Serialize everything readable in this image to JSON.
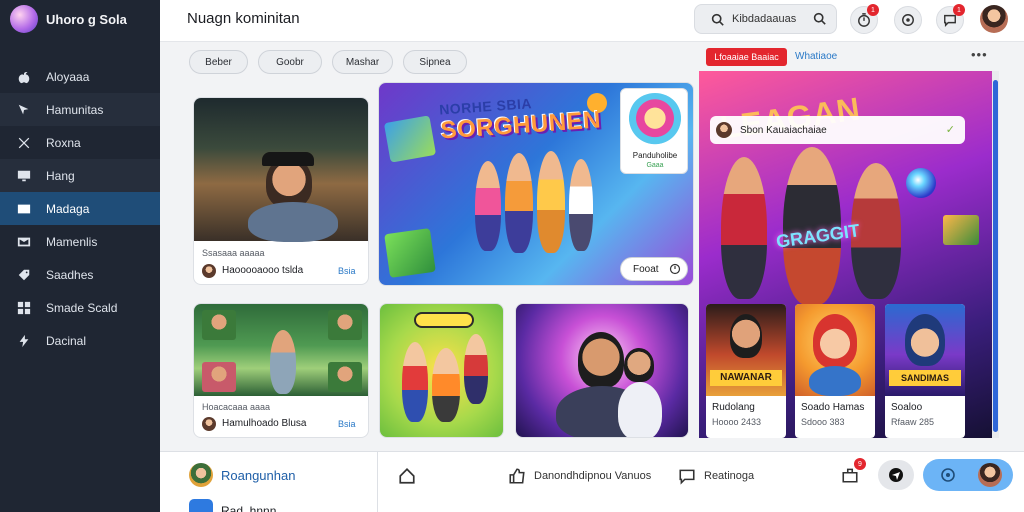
{
  "app": {
    "name": "Uhoro g Sola"
  },
  "sidebar": {
    "items": [
      {
        "label": "Aloyaaa",
        "icon": "apple-icon"
      },
      {
        "label": "Hamunitas",
        "icon": "cursor-icon"
      },
      {
        "label": "Roxna",
        "icon": "cross-icon"
      },
      {
        "label": "Hang",
        "icon": "monitor-icon"
      },
      {
        "label": "Madaga",
        "icon": "media-icon",
        "active": true
      },
      {
        "label": "Mamenlis",
        "icon": "inbox-icon"
      },
      {
        "label": "Saadhes",
        "icon": "tag-icon"
      },
      {
        "label": "Smade Scald",
        "icon": "grid-icon"
      },
      {
        "label": "Dacinal",
        "icon": "bolt-icon"
      }
    ]
  },
  "header": {
    "title": "Nuagn kominitan",
    "search_value": "Kibdadaauas",
    "notif_badge": "1",
    "msg_badge": "1",
    "icons": [
      "timer-icon",
      "record-icon",
      "chat-icon"
    ]
  },
  "chips": [
    "Beber",
    "Goobr",
    "Mashar",
    "Sipnea"
  ],
  "cards": {
    "street": {
      "meta": "Ssasaaa aaaaa",
      "author": "Haooooaooo tslda",
      "action": "Bsia"
    },
    "park": {
      "meta": "Hoacacaaa aaaa",
      "author": "Hamulhoado Blusa",
      "action": "Bsia"
    }
  },
  "hero": {
    "title_line1": "NORHE SBIA",
    "title_line2": "SORGHUNEN",
    "promo_label": "Panduholibe",
    "promo_sub": "Gaaa",
    "more_label": "Fooat"
  },
  "right_panel": {
    "live_label": "Lfoaaiae Baaiac",
    "title": "Whatiaoe",
    "overlay_text": "Sbon Kauaiachaiae",
    "feature_title": "LEAGAN",
    "neon_text": "GRAGGIT",
    "streams": [
      {
        "name": "Rudolang",
        "count": "Hoooo 2433"
      },
      {
        "name": "Soado Hamas",
        "count": "Sdooo 383"
      },
      {
        "name": "Soaloo",
        "count": "Rfaaw 285"
      }
    ],
    "stream_badges": [
      "NAWANAR",
      "",
      "SANDIMAS"
    ]
  },
  "bottom": {
    "profile_name": "Roangunhan",
    "app_label": "Rad. hnnn",
    "likes_label": "Danondhdipnou Vanuos",
    "comments_label": "Reatinoga",
    "share_badge": "9"
  },
  "colors": {
    "sidebar_bg": "#1f2633",
    "active_nav": "#1f4d78",
    "live_red": "#e3262e",
    "link_blue": "#2a79c7",
    "cta_blue": "#6cb4f6"
  }
}
